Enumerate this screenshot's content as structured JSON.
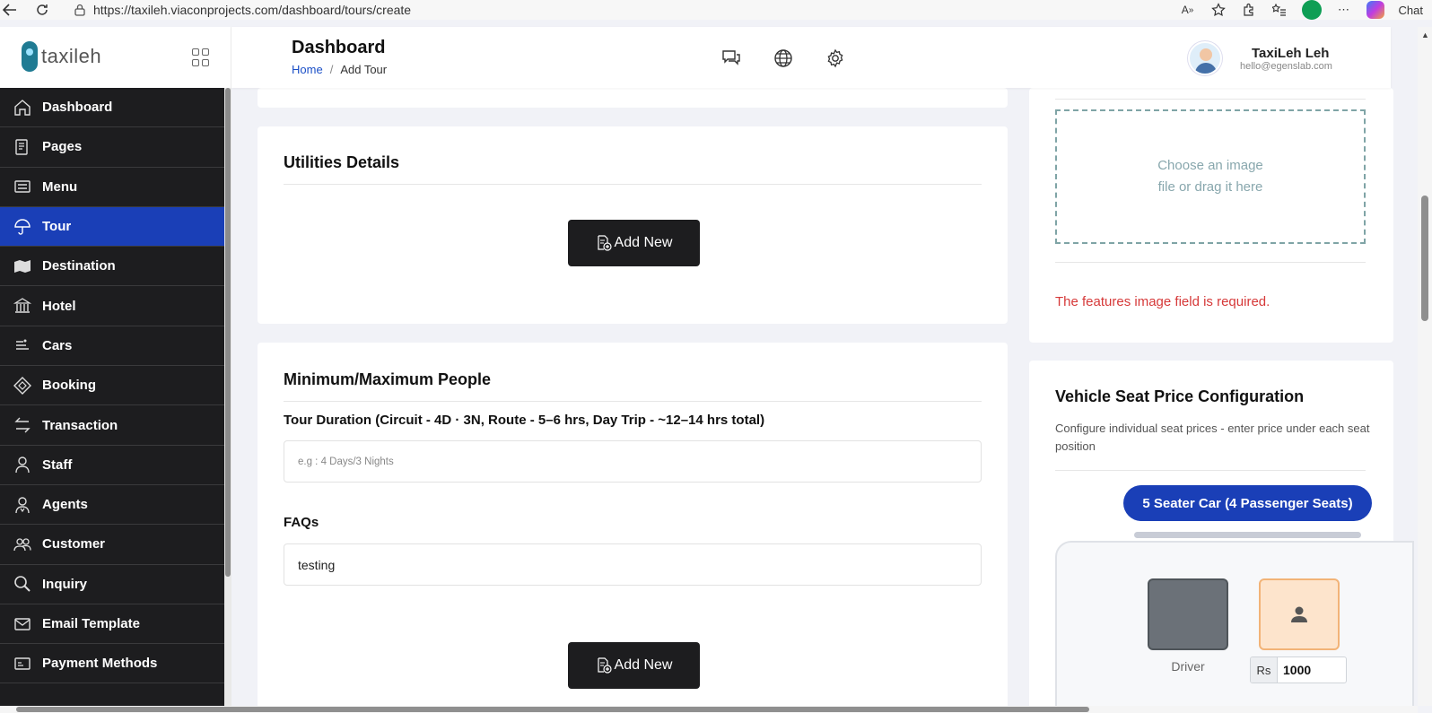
{
  "browser": {
    "url": "https://taxileh.viaconprojects.com/dashboard/tours/create",
    "chat_label": "Chat"
  },
  "sidebar": {
    "logo_text": "taxileh",
    "items": [
      {
        "label": "Dashboard",
        "icon": "home-icon"
      },
      {
        "label": "Pages",
        "icon": "pages-icon"
      },
      {
        "label": "Menu",
        "icon": "menu-icon"
      },
      {
        "label": "Tour",
        "icon": "umbrella-icon",
        "active": true
      },
      {
        "label": "Destination",
        "icon": "map-icon"
      },
      {
        "label": "Hotel",
        "icon": "bank-icon"
      },
      {
        "label": "Cars",
        "icon": "car-icon"
      },
      {
        "label": "Booking",
        "icon": "booking-icon"
      },
      {
        "label": "Transaction",
        "icon": "transfer-icon"
      },
      {
        "label": "Staff",
        "icon": "staff-icon"
      },
      {
        "label": "Agents",
        "icon": "agent-icon"
      },
      {
        "label": "Customer",
        "icon": "customer-icon"
      },
      {
        "label": "Inquiry",
        "icon": "search-icon"
      },
      {
        "label": "Email Template",
        "icon": "mail-icon"
      },
      {
        "label": "Payment Methods",
        "icon": "payment-icon"
      }
    ]
  },
  "header": {
    "title": "Dashboard",
    "breadcrumb_home": "Home",
    "breadcrumb_sep": "/",
    "breadcrumb_current": "Add Tour",
    "user_name": "TaxiLeh Leh",
    "user_email": "hello@egenslab.com"
  },
  "utilities": {
    "title": "Utilities Details",
    "add_button": "Add New"
  },
  "people": {
    "title": "Minimum/Maximum People",
    "duration_label": "Tour Duration (Circuit - 4D · 3N, Route - 5–6 hrs, Day Trip - ~12–14 hrs total)",
    "duration_placeholder": "e.g : 4 Days/3 Nights",
    "faqs_label": "FAQs",
    "faqs_value": "testing",
    "add_button": "Add New"
  },
  "image_upload": {
    "line1": "Choose an image",
    "line2": "file or drag it here",
    "error": "The features image field is required."
  },
  "vehicle": {
    "title": "Vehicle Seat Price Configuration",
    "description": "Configure individual seat prices - enter price under each seat position",
    "car_button": "5 Seater Car (4 Passenger Seats)",
    "driver_label": "Driver",
    "price_prefix": "Rs",
    "price_value": "1000"
  },
  "colors": {
    "primary": "#1a3fb7",
    "sidebar_bg": "#1d1d1f",
    "error": "#d63939"
  }
}
